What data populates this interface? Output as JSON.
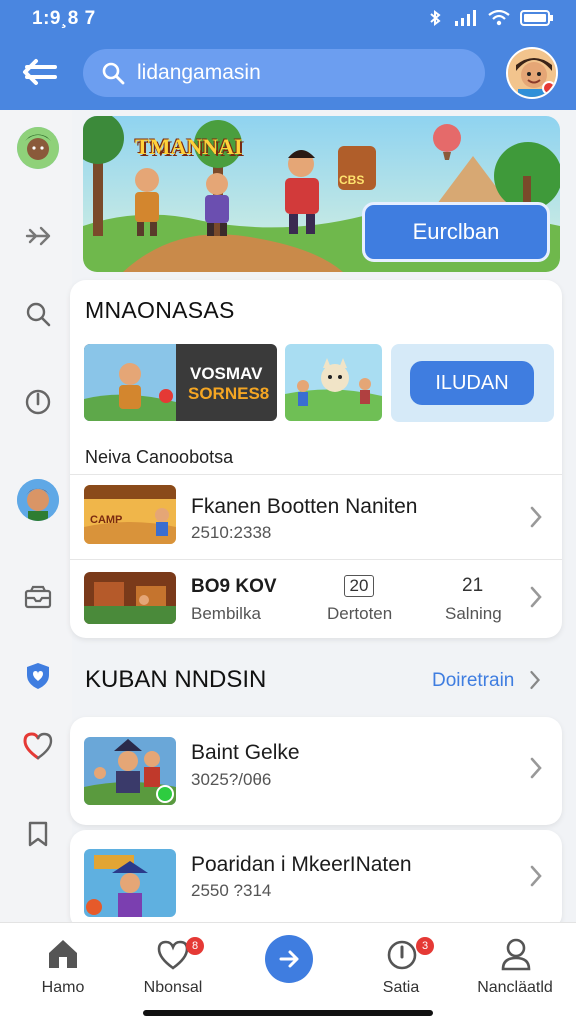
{
  "status_bar": {
    "time": "1:9¸8 7"
  },
  "header": {
    "search_text": "lidangamasin"
  },
  "banner": {
    "art_title": "TMANNAI",
    "button_label": "Eurclban"
  },
  "card1": {
    "title": "MNAONASAS",
    "promo_text_1": "VOSMAV",
    "promo_text_2": "SORNES8",
    "ludan_button": "ILUDAN",
    "subheading": "Neiva  Canoobotsa",
    "row1": {
      "title": "Fkanen Bootten Naniten",
      "meta": "2510:2338"
    },
    "row2": {
      "title": "BO9 KOV",
      "meta": "Bembilka",
      "stat1_value": "20",
      "stat1_label": "Dertoten",
      "stat2_value": "21",
      "stat2_label": "Salning"
    }
  },
  "section2": {
    "title": "KUBAN NNDSIN",
    "link": "Doiretrain",
    "items": [
      {
        "title": "Baint Gelke",
        "meta": "3025?/0θ6"
      },
      {
        "title": "Poaridan i MkeerINaten",
        "meta": "2550 ?314"
      }
    ]
  },
  "bottom_nav": [
    {
      "label": "Hamo",
      "icon": "home-icon"
    },
    {
      "label": "Nbonsal",
      "icon": "heart-icon",
      "badge": "8"
    },
    {
      "label": "",
      "icon": "arrow-right-icon"
    },
    {
      "label": "Satia",
      "icon": "alert-icon",
      "badge": "3"
    },
    {
      "label": "Nancläatld",
      "icon": "profile-icon"
    }
  ],
  "colors": {
    "primary": "#4a86e0",
    "accent": "#3f7de0",
    "badge": "#e53935"
  }
}
